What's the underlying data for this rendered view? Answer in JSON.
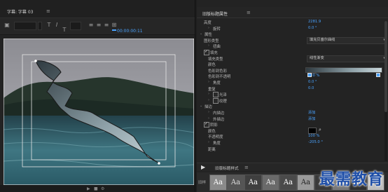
{
  "left_panel": {
    "tab_title": "字幕: 字幕 03",
    "menu_glyph": "≡",
    "timecode": "00:00:00:11",
    "toolbar_icons": [
      "bold-icon",
      "italic-icon",
      "underline-icon",
      "text-align-left-icon",
      "text-align-center-icon",
      "text-align-right-icon",
      "tab-stops-icon",
      "play-icon"
    ],
    "status_icons": [
      "play-icon",
      "stop-icon",
      "settings-icon"
    ]
  },
  "right_panel": {
    "title": "旧版标题属性",
    "menu_glyph": "≡",
    "rows": [
      {
        "type": "label_value",
        "indent": 0,
        "label": "高度",
        "value": "2281.9"
      },
      {
        "type": "arrow_label_value",
        "indent": 1,
        "label": "旋转",
        "value": "0.0 °"
      },
      {
        "type": "section",
        "label": "属性"
      },
      {
        "type": "label_select",
        "indent": 0,
        "label": "图形类型",
        "select": "填充贝塞尔曲线"
      },
      {
        "type": "arrow_label",
        "indent": 1,
        "label": "扭曲"
      },
      {
        "type": "check_label",
        "indent": 0,
        "label": "填充",
        "checked": true
      },
      {
        "type": "label_select",
        "indent": 1,
        "label": "填充类型",
        "select": "线性渐变"
      },
      {
        "type": "label",
        "indent": 1,
        "label": "颜色"
      },
      {
        "type": "label_swatch",
        "indent": 1,
        "label": "色彩到色彩",
        "swatch_color": "#9aaab0"
      },
      {
        "type": "label_value",
        "indent": 1,
        "label": "色彩到不透明",
        "value": "100 %"
      },
      {
        "type": "arrow_label_value",
        "indent": 1,
        "label": "角度",
        "value": "0.0 °"
      },
      {
        "type": "label_value",
        "indent": 1,
        "label": "重复",
        "value": "0.0"
      },
      {
        "type": "arrow_check_label",
        "indent": 1,
        "label": "光泽"
      },
      {
        "type": "arrow_check_label",
        "indent": 1,
        "label": "纹理"
      },
      {
        "type": "section",
        "label": "描边"
      },
      {
        "type": "arrow_label_link",
        "indent": 1,
        "label": "内描边",
        "value": "添加"
      },
      {
        "type": "arrow_label_link",
        "indent": 1,
        "label": "外描边",
        "value": "添加"
      },
      {
        "type": "check_label",
        "indent": 0,
        "label": "阴影",
        "checked": true
      },
      {
        "type": "label_swatch",
        "indent": 1,
        "label": "颜色",
        "swatch_color": "#000000"
      },
      {
        "type": "label_value",
        "indent": 1,
        "label": "不透明度",
        "value": "100 %"
      },
      {
        "type": "arrow_label_value",
        "indent": 1,
        "label": "角度",
        "value": "-205.0 °"
      },
      {
        "type": "label_value",
        "indent": 1,
        "label": "距离",
        "value": ""
      }
    ],
    "gradient": {
      "from": "#2f3a40",
      "to": "#c8d6da"
    }
  },
  "styles_panel": {
    "title": "旧版标题样式",
    "menu_glyph": "≡",
    "pointer_glyph": "▶",
    "row_label": "旧样",
    "samples": [
      "Aa",
      "Aa",
      "Aa",
      "Aa",
      "Aa",
      "Aa",
      "Aa",
      "Aa",
      "Aa",
      "Aa"
    ]
  },
  "watermark": "最需教育",
  "colors": {
    "accent": "#4aa3ff",
    "panel": "#232323",
    "water": "#3c6d78"
  }
}
